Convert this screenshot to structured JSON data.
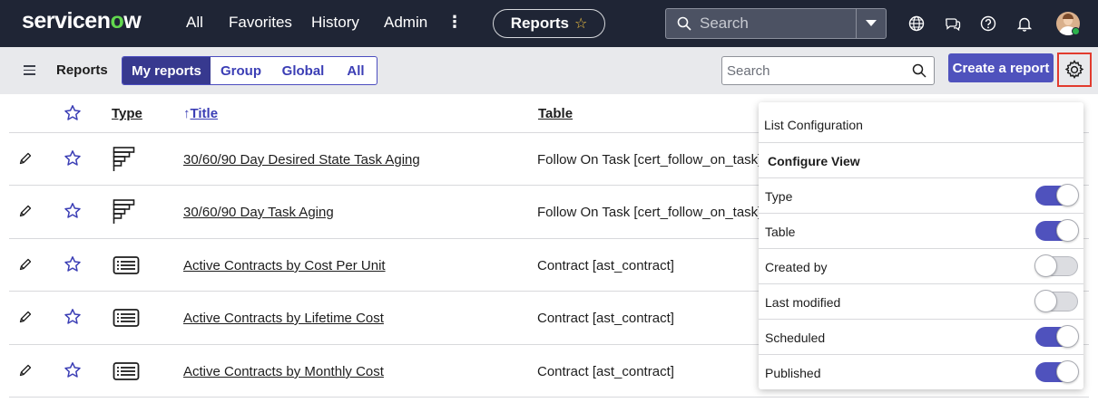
{
  "topnav": {
    "logo_text": "servicenow",
    "links": [
      "All",
      "Favorites",
      "History",
      "Admin"
    ],
    "kebab": "⋮",
    "app_pill": "Reports",
    "search_placeholder": "Search",
    "icons": [
      "globe-icon",
      "chat-icon",
      "help-icon",
      "bell-icon",
      "user-avatar"
    ]
  },
  "subheader": {
    "menu_icon": "hamburger-icon",
    "title": "Reports",
    "segments": [
      "My reports",
      "Group",
      "Global",
      "All"
    ],
    "active_segment": "My reports",
    "search_placeholder": "Search",
    "create_button": "Create a report",
    "settings_icon": "gear-icon"
  },
  "table": {
    "headers": {
      "type": "Type",
      "sort_arrow": "↑",
      "title": "Title",
      "table": "Table"
    },
    "rows": [
      {
        "icon": "horizontal-bar-chart-icon",
        "title": "30/60/90 Day Desired State Task Aging",
        "table": "Follow On Task [cert_follow_on_task]"
      },
      {
        "icon": "horizontal-bar-chart-icon",
        "title": "30/60/90 Day Task Aging",
        "table": "Follow On Task [cert_follow_on_task]"
      },
      {
        "icon": "list-report-icon",
        "title": "Active Contracts by Cost Per Unit",
        "table": "Contract [ast_contract]"
      },
      {
        "icon": "list-report-icon",
        "title": "Active Contracts by Lifetime Cost",
        "table": "Contract [ast_contract]"
      },
      {
        "icon": "list-report-icon",
        "title": "Active Contracts by Monthly Cost",
        "table": "Contract [ast_contract]"
      }
    ]
  },
  "list_config": {
    "title": "List Configuration",
    "section": "Configure View",
    "options": [
      {
        "label": "Type",
        "enabled": true
      },
      {
        "label": "Table",
        "enabled": true
      },
      {
        "label": "Created by",
        "enabled": false
      },
      {
        "label": "Last modified",
        "enabled": false
      },
      {
        "label": "Scheduled",
        "enabled": true
      },
      {
        "label": "Published",
        "enabled": true
      }
    ]
  },
  "colors": {
    "nav_bg": "#1f2535",
    "accent": "#4f52bd",
    "active_segment": "#37398f",
    "highlight_border": "#e23b2e",
    "logo_accent": "#62d84e"
  }
}
